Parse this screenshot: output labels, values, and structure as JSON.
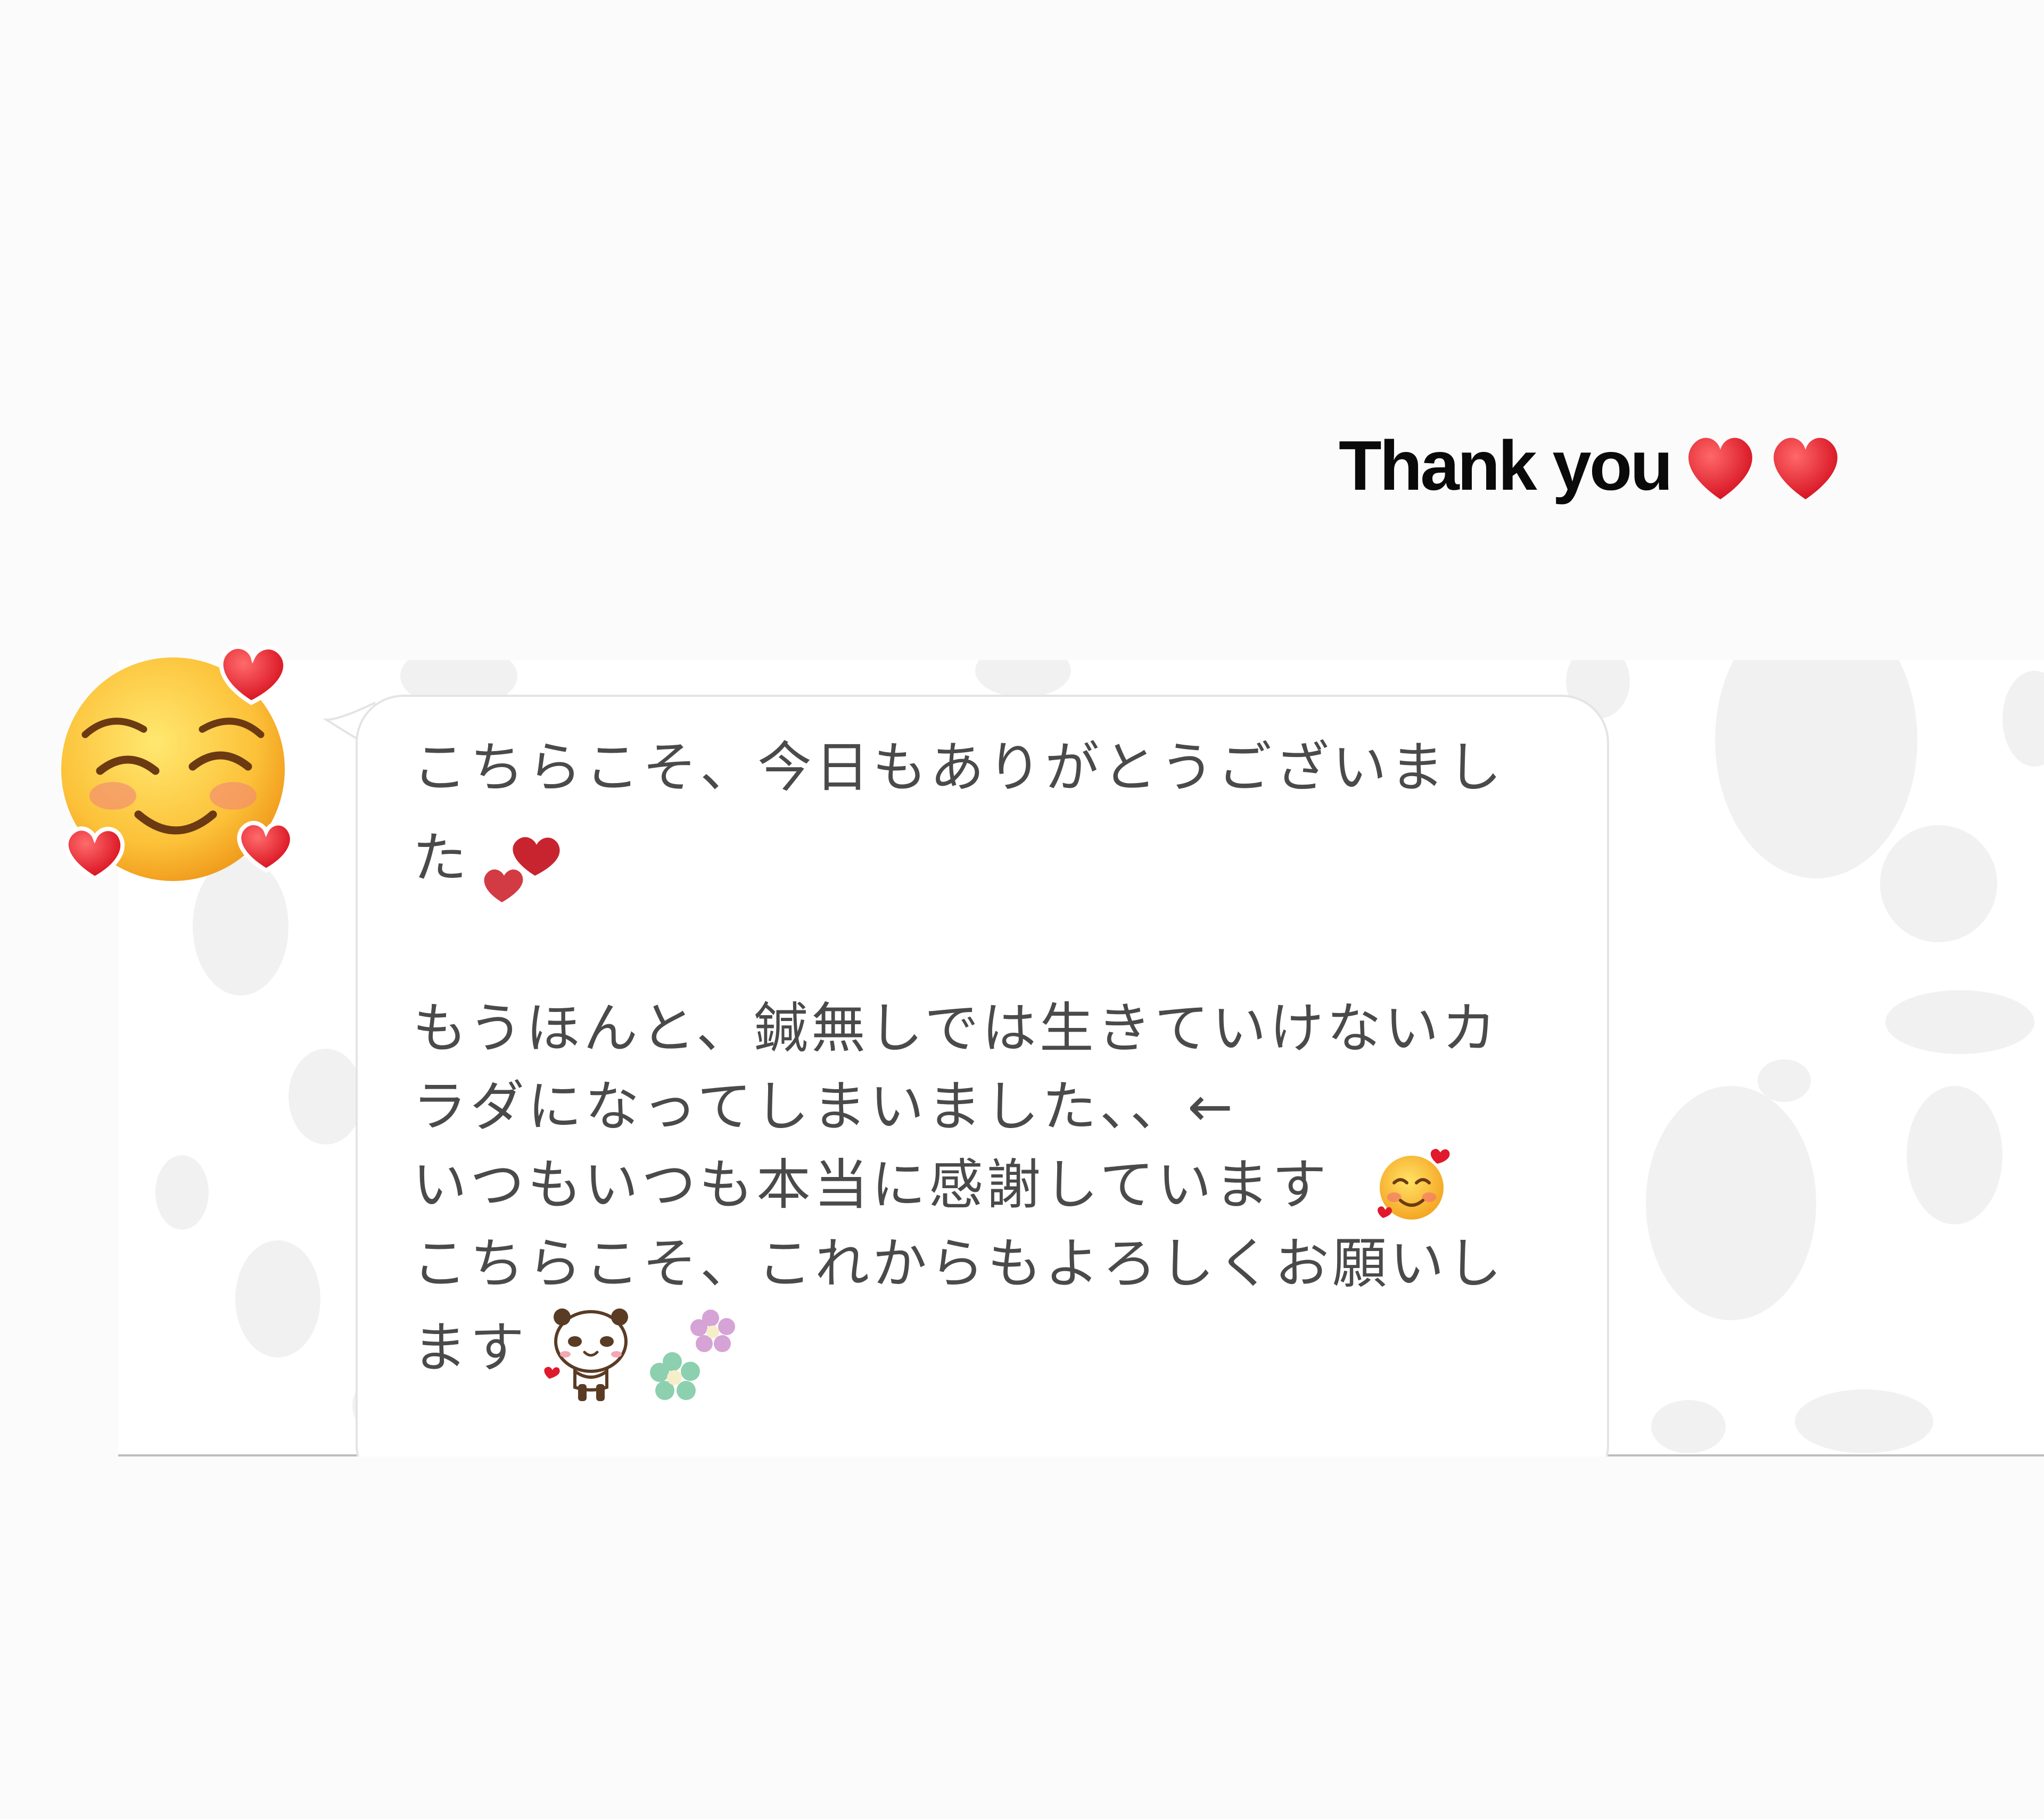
{
  "caption": {
    "text": "Thank you",
    "trailing_icons": [
      "red-heart",
      "red-heart"
    ]
  },
  "sticker": {
    "icon": "smiling-face-with-hearts"
  },
  "message": {
    "lines": [
      "こちらこそ、今日もありがとうございまし",
      "た",
      "もうほんと、鍼無しでは生きていけないカ",
      "ラダになってしまいました、、←",
      "いつもいつも本当に感謝しています",
      "こちらこそ、これからもよろしくお願いし",
      "ます"
    ],
    "inline_icons": [
      "two-hearts",
      "smiling-face-with-hearts",
      "panda-sticker",
      "flowers"
    ]
  },
  "colors": {
    "page_background": "#fbfbfb",
    "chat_background": "#ffffff",
    "bubble_border": "#e4e4e4",
    "message_text": "#4a4a4a",
    "caption_text": "#0a0a0a",
    "heart_red": "#e0192b"
  }
}
